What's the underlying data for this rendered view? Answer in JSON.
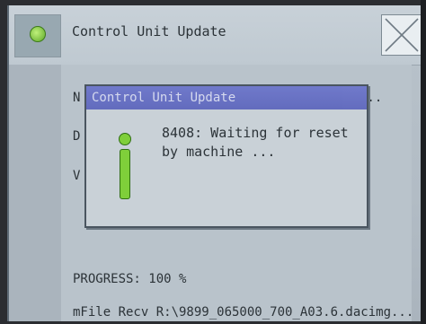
{
  "window": {
    "title": "Control Unit Update",
    "close_icon": "close-x-icon",
    "app_icon": "green-status-icon"
  },
  "fields": {
    "n_label": "N",
    "n_value_trailing": "...",
    "d_label": "D",
    "v_label": "V"
  },
  "progress": {
    "text": "PROGRESS: 100 %",
    "value": 100
  },
  "status": {
    "text": "mFile Recv R:\\9899_065000_700_A03.6.dacimg..."
  },
  "dialog": {
    "title": "Control Unit Update",
    "message": "8408: Waiting for reset by machine ...",
    "icon": "info-icon"
  },
  "colors": {
    "dialog_title_bg": "#4a53b8",
    "info_icon": "#7fcf3a",
    "screen_bg": "#b9c3cb"
  }
}
